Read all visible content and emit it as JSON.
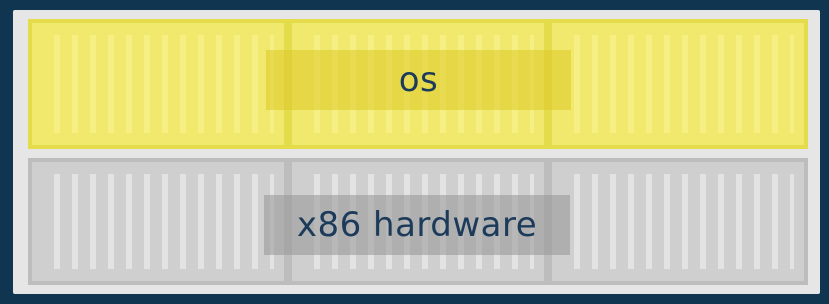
{
  "diagram": {
    "layers": [
      {
        "id": "os",
        "label": "os",
        "color": "#ebe35a"
      },
      {
        "id": "hardware",
        "label": "x86 hardware",
        "color": "#c8c8c8"
      }
    ]
  },
  "colors": {
    "background": "#0f3550",
    "panel": "#e6e6e6",
    "text": "#1c3a5a"
  }
}
